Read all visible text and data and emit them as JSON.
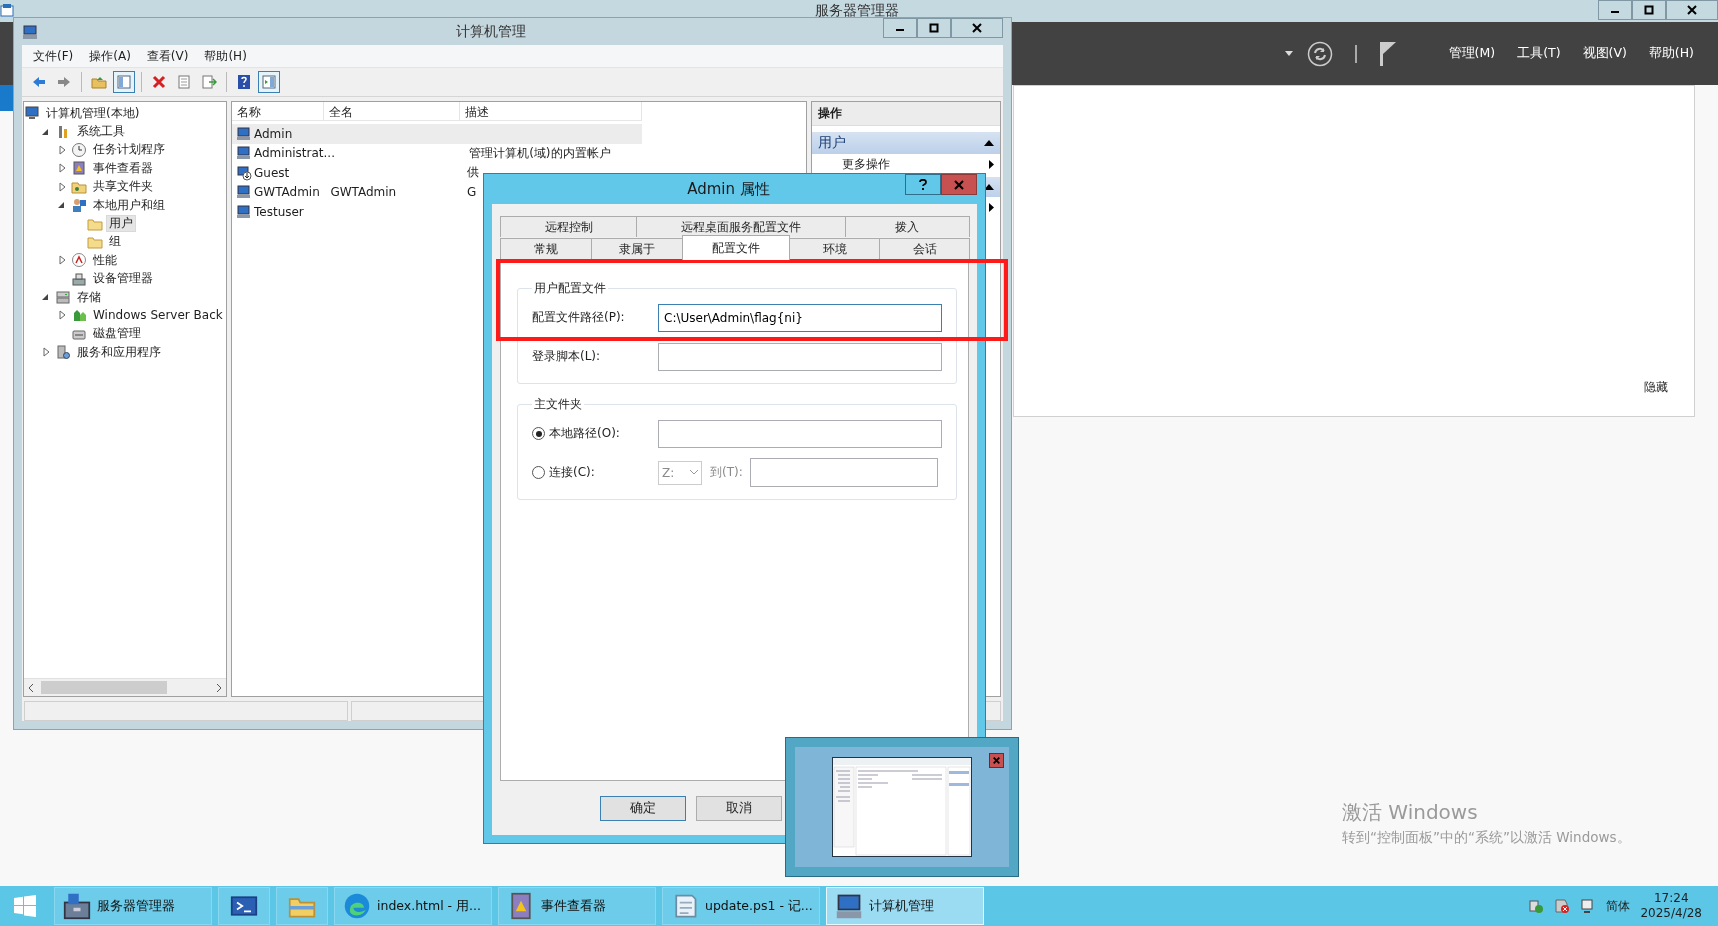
{
  "server_manager": {
    "title": "服务器管理器",
    "menu": [
      "管理(M)",
      "工具(T)",
      "视图(V)",
      "帮助(H)"
    ],
    "hide_link": "隐藏"
  },
  "computer_management": {
    "title": "计算机管理",
    "menu": [
      "文件(F)",
      "操作(A)",
      "查看(V)",
      "帮助(H)"
    ],
    "toolbar": [
      {
        "pressed": false
      },
      {
        "pressed": false
      },
      {
        "pressed": false
      },
      {
        "pressed": true
      },
      {
        "pressed": false
      },
      {
        "pressed": false
      },
      {
        "pressed": false
      },
      {
        "pressed": false
      },
      {
        "pressed": true
      }
    ],
    "tree": [
      {
        "label": "计算机管理(本地)",
        "kind": "computer",
        "selected": false,
        "children": [
          {
            "label": "系统工具",
            "kind": "tools",
            "expanded": true,
            "selected": false,
            "children": [
              {
                "label": "任务计划程序",
                "kind": "clock",
                "expanded": false,
                "selected": false
              },
              {
                "label": "事件查看器",
                "kind": "log",
                "expanded": false,
                "selected": false
              },
              {
                "label": "共享文件夹",
                "kind": "share",
                "expanded": false,
                "selected": false
              },
              {
                "label": "本地用户和组",
                "kind": "users",
                "expanded": true,
                "selected": false,
                "children": [
                  {
                    "label": "用户",
                    "kind": "folder",
                    "selected": true
                  },
                  {
                    "label": "组",
                    "kind": "folder",
                    "selected": false
                  }
                ]
              },
              {
                "label": "性能",
                "kind": "gauge",
                "expanded": false,
                "selected": false
              },
              {
                "label": "设备管理器",
                "kind": "device",
                "selected": false
              }
            ]
          },
          {
            "label": "存储",
            "kind": "storage",
            "expanded": true,
            "selected": false,
            "children": [
              {
                "label": "Windows Server Back",
                "kind": "backup",
                "expanded": false,
                "selected": false
              },
              {
                "label": "磁盘管理",
                "kind": "disk",
                "selected": false
              }
            ]
          },
          {
            "label": "服务和应用程序",
            "kind": "services",
            "expanded": false,
            "selected": false
          }
        ]
      }
    ],
    "list": {
      "columns": [
        "名称",
        "全名",
        "描述"
      ],
      "rows": [
        {
          "name": "Admin",
          "disabled": false,
          "selected": true
        },
        {
          "name": "Administrat...",
          "description": "管理计算机(域)的内置帐户",
          "disabled": false,
          "selected": false
        },
        {
          "name": "Guest",
          "description": "供",
          "disabled": true,
          "selected": false
        },
        {
          "name": "GWTAdmin",
          "full_name": "GWTAdmin",
          "description": "G",
          "disabled": false,
          "selected": false
        },
        {
          "name": "Testuser",
          "disabled": false,
          "selected": false
        }
      ]
    },
    "actions": {
      "title": "操作",
      "section": "用户",
      "expanded": true,
      "items": [
        "更多操作"
      ]
    }
  },
  "dialog": {
    "title": "Admin 属性",
    "tab_rows": [
      [
        {
          "label": "远程控制",
          "selected": false
        },
        {
          "label": "远程桌面服务配置文件",
          "selected": false
        },
        {
          "label": "拨入",
          "selected": false
        }
      ],
      [
        {
          "label": "常规",
          "selected": false
        },
        {
          "label": "隶属于",
          "selected": false
        },
        {
          "label": "配置文件",
          "selected": true
        },
        {
          "label": "环境",
          "selected": false
        },
        {
          "label": "会话",
          "selected": false
        }
      ]
    ],
    "profile_group": {
      "title": "用户配置文件",
      "fields": [
        {
          "label": "配置文件路径(P):",
          "value": "C:\\User\\Admin\\flag{ni}"
        },
        {
          "label": "登录脚本(L):"
        }
      ]
    },
    "home_group": {
      "title": "主文件夹",
      "local": {
        "label": "本地路径(O):",
        "selected": true
      },
      "connect": {
        "label": "连接(C):",
        "selected": false,
        "drive": "Z:",
        "to_label": "到(T):"
      }
    },
    "buttons": [
      {
        "label": "确定",
        "default": true
      },
      {
        "label": "取消",
        "default": false
      }
    ]
  },
  "activation": {
    "title": "激活 Windows",
    "text": "转到“控制面板”中的“系统”以激活 Windows。"
  },
  "taskbar": {
    "items": [
      {
        "kind": "server",
        "label": "服务器管理器",
        "selected": false
      },
      {
        "kind": "terminal",
        "selected": false
      },
      {
        "kind": "folder",
        "selected": false
      },
      {
        "kind": "browser",
        "label": "index.html - 用...",
        "selected": false
      },
      {
        "kind": "log",
        "label": "事件查看器",
        "selected": false
      },
      {
        "kind": "notepad",
        "label": "update.ps1 - 记...",
        "selected": false
      },
      {
        "kind": "computer",
        "label": "计算机管理",
        "selected": true
      }
    ],
    "tray": {
      "language": "简体",
      "time": "17:24",
      "date": "2025/4/28"
    }
  }
}
